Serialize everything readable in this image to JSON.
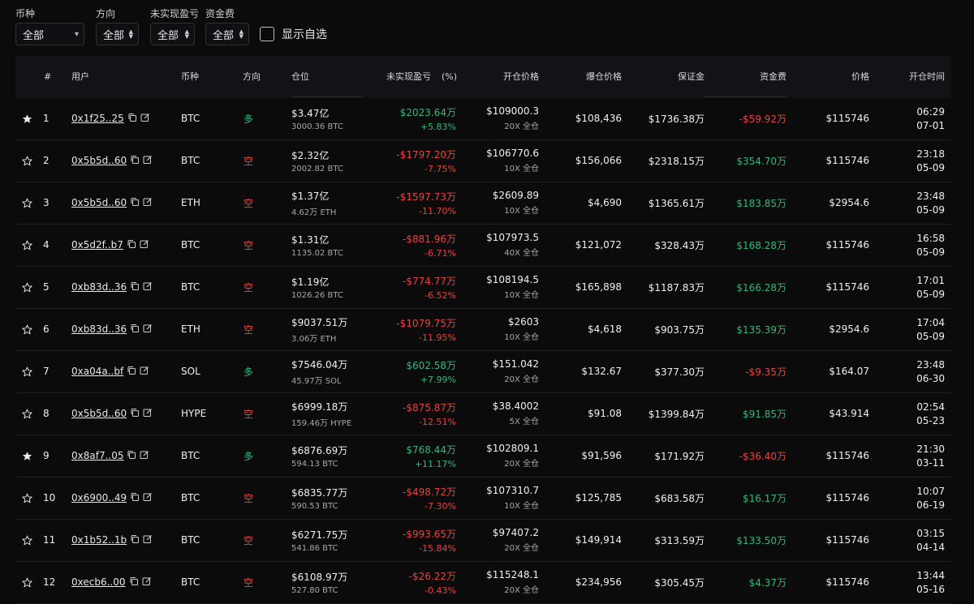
{
  "filters": {
    "coin": {
      "label": "币种",
      "value": "全部"
    },
    "direction": {
      "label": "方向",
      "value": "全部"
    },
    "unrealized": {
      "label": "未实现盈亏",
      "value": "全部"
    },
    "funding": {
      "label": "资金费",
      "value": "全部"
    },
    "show_favorites": "显示自选"
  },
  "colors": {
    "green": "#33b77a",
    "red": "#e5453f",
    "bg": "#0b0b0c"
  },
  "table": {
    "headers": {
      "index": "#",
      "user": "用户",
      "coin": "币种",
      "direction": "方向",
      "position": "仓位",
      "pnl": "未实现盈亏",
      "pnl_pct": "(%)",
      "entry": "开仓价格",
      "liq": "爆仓价格",
      "margin": "保证金",
      "funding": "资金费",
      "price": "价格",
      "time": "开仓时间"
    },
    "rows": [
      {
        "fav": true,
        "idx": "1",
        "user": "0x1f25..25",
        "coin": "BTC",
        "dir": "多",
        "dir_type": "long",
        "pos": "$3.47亿",
        "pos_sub": "3000.36 BTC",
        "pnl": "$2023.64万",
        "pnl_pct": "+5.83%",
        "pnl_type": "up",
        "entry": "$109000.3",
        "entry_sub": "20X 全仓",
        "liq": "$108,436",
        "margin": "$1736.38万",
        "funding": "-$59.92万",
        "funding_type": "down",
        "price": "$115746",
        "time": "06:29",
        "date": "07-01"
      },
      {
        "fav": false,
        "idx": "2",
        "user": "0x5b5d..60",
        "coin": "BTC",
        "dir": "空",
        "dir_type": "short",
        "pos": "$2.32亿",
        "pos_sub": "2002.82 BTC",
        "pnl": "-$1797.20万",
        "pnl_pct": "-7.75%",
        "pnl_type": "down",
        "entry": "$106770.6",
        "entry_sub": "10X 全仓",
        "liq": "$156,066",
        "margin": "$2318.15万",
        "funding": "$354.70万",
        "funding_type": "up",
        "price": "$115746",
        "time": "23:18",
        "date": "05-09"
      },
      {
        "fav": false,
        "idx": "3",
        "user": "0x5b5d..60",
        "coin": "ETH",
        "dir": "空",
        "dir_type": "short",
        "pos": "$1.37亿",
        "pos_sub": "4.62万 ETH",
        "pnl": "-$1597.73万",
        "pnl_pct": "-11.70%",
        "pnl_type": "down",
        "entry": "$2609.89",
        "entry_sub": "10X 全仓",
        "liq": "$4,690",
        "margin": "$1365.61万",
        "funding": "$183.85万",
        "funding_type": "up",
        "price": "$2954.6",
        "time": "23:48",
        "date": "05-09"
      },
      {
        "fav": false,
        "idx": "4",
        "user": "0x5d2f..b7",
        "coin": "BTC",
        "dir": "空",
        "dir_type": "short",
        "pos": "$1.31亿",
        "pos_sub": "1135.02 BTC",
        "pnl": "-$881.96万",
        "pnl_pct": "-6.71%",
        "pnl_type": "down",
        "entry": "$107973.5",
        "entry_sub": "40X 全仓",
        "liq": "$121,072",
        "margin": "$328.43万",
        "funding": "$168.28万",
        "funding_type": "up",
        "price": "$115746",
        "time": "16:58",
        "date": "05-09"
      },
      {
        "fav": false,
        "idx": "5",
        "user": "0xb83d..36",
        "coin": "BTC",
        "dir": "空",
        "dir_type": "short",
        "pos": "$1.19亿",
        "pos_sub": "1026.26 BTC",
        "pnl": "-$774.77万",
        "pnl_pct": "-6.52%",
        "pnl_type": "down",
        "entry": "$108194.5",
        "entry_sub": "10X 全仓",
        "liq": "$165,898",
        "margin": "$1187.83万",
        "funding": "$166.28万",
        "funding_type": "up",
        "price": "$115746",
        "time": "17:01",
        "date": "05-09"
      },
      {
        "fav": false,
        "idx": "6",
        "user": "0xb83d..36",
        "coin": "ETH",
        "dir": "空",
        "dir_type": "short",
        "pos": "$9037.51万",
        "pos_sub": "3.06万 ETH",
        "pnl": "-$1079.75万",
        "pnl_pct": "-11.95%",
        "pnl_type": "down",
        "entry": "$2603",
        "entry_sub": "10X 全仓",
        "liq": "$4,618",
        "margin": "$903.75万",
        "funding": "$135.39万",
        "funding_type": "up",
        "price": "$2954.6",
        "time": "17:04",
        "date": "05-09"
      },
      {
        "fav": false,
        "idx": "7",
        "user": "0xa04a..bf",
        "coin": "SOL",
        "dir": "多",
        "dir_type": "long",
        "pos": "$7546.04万",
        "pos_sub": "45.97万 SOL",
        "pnl": "$602.58万",
        "pnl_pct": "+7.99%",
        "pnl_type": "up",
        "entry": "$151.042",
        "entry_sub": "20X 全仓",
        "liq": "$132.67",
        "margin": "$377.30万",
        "funding": "-$9.35万",
        "funding_type": "down",
        "price": "$164.07",
        "time": "23:48",
        "date": "06-30"
      },
      {
        "fav": false,
        "idx": "8",
        "user": "0x5b5d..60",
        "coin": "HYPE",
        "dir": "空",
        "dir_type": "short",
        "pos": "$6999.18万",
        "pos_sub": "159.46万 HYPE",
        "pnl": "-$875.87万",
        "pnl_pct": "-12.51%",
        "pnl_type": "down",
        "entry": "$38.4002",
        "entry_sub": "5X 全仓",
        "liq": "$91.08",
        "margin": "$1399.84万",
        "funding": "$91.85万",
        "funding_type": "up",
        "price": "$43.914",
        "time": "02:54",
        "date": "05-23"
      },
      {
        "fav": true,
        "idx": "9",
        "user": "0x8af7..05",
        "coin": "BTC",
        "dir": "多",
        "dir_type": "long",
        "pos": "$6876.69万",
        "pos_sub": "594.13 BTC",
        "pnl": "$768.44万",
        "pnl_pct": "+11.17%",
        "pnl_type": "up",
        "entry": "$102809.1",
        "entry_sub": "20X 全仓",
        "liq": "$91,596",
        "margin": "$171.92万",
        "funding": "-$36.40万",
        "funding_type": "down",
        "price": "$115746",
        "time": "21:30",
        "date": "03-11"
      },
      {
        "fav": false,
        "idx": "10",
        "user": "0x6900..49",
        "coin": "BTC",
        "dir": "空",
        "dir_type": "short",
        "pos": "$6835.77万",
        "pos_sub": "590.53 BTC",
        "pnl": "-$498.72万",
        "pnl_pct": "-7.30%",
        "pnl_type": "down",
        "entry": "$107310.7",
        "entry_sub": "10X 全仓",
        "liq": "$125,785",
        "margin": "$683.58万",
        "funding": "$16.17万",
        "funding_type": "up",
        "price": "$115746",
        "time": "10:07",
        "date": "06-19"
      },
      {
        "fav": false,
        "idx": "11",
        "user": "0x1b52..1b",
        "coin": "BTC",
        "dir": "空",
        "dir_type": "short",
        "pos": "$6271.75万",
        "pos_sub": "541.86 BTC",
        "pnl": "-$993.65万",
        "pnl_pct": "-15.84%",
        "pnl_type": "down",
        "entry": "$97407.2",
        "entry_sub": "20X 全仓",
        "liq": "$149,914",
        "margin": "$313.59万",
        "funding": "$133.50万",
        "funding_type": "up",
        "price": "$115746",
        "time": "03:15",
        "date": "04-14"
      },
      {
        "fav": false,
        "idx": "12",
        "user": "0xecb6..00",
        "coin": "BTC",
        "dir": "空",
        "dir_type": "short",
        "pos": "$6108.97万",
        "pos_sub": "527.80 BTC",
        "pnl": "-$26.22万",
        "pnl_pct": "-0.43%",
        "pnl_type": "down",
        "entry": "$115248.1",
        "entry_sub": "20X 全仓",
        "liq": "$234,956",
        "margin": "$305.45万",
        "funding": "$4.37万",
        "funding_type": "up",
        "price": "$115746",
        "time": "13:44",
        "date": "05-16"
      }
    ]
  }
}
